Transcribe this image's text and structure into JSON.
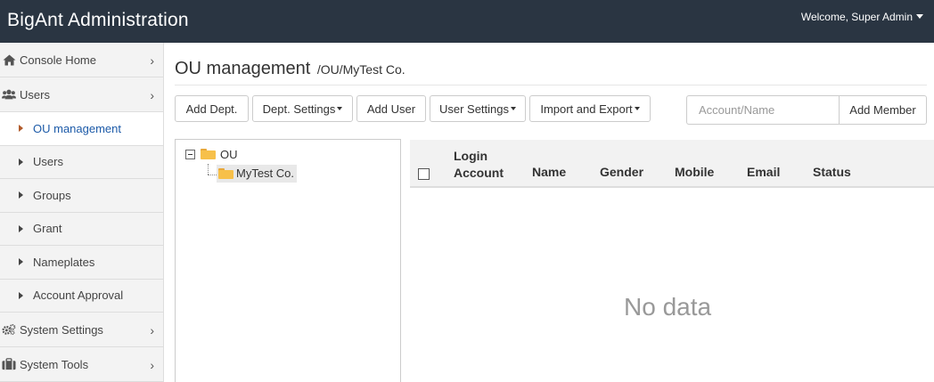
{
  "app": {
    "title": "BigAnt Administration",
    "welcome": "Welcome, Super Admin"
  },
  "sidebar": {
    "console_home": "Console Home",
    "users": "Users",
    "sub_items": [
      "OU management",
      "Users",
      "Groups",
      "Grant",
      "Nameplates",
      "Account Approval"
    ],
    "system_settings": "System Settings",
    "system_tools": "System Tools",
    "active_item": "OU management"
  },
  "page": {
    "title": "OU management",
    "breadcrumb": "/OU/MyTest Co."
  },
  "toolbar": {
    "add_dept": "Add Dept.",
    "dept_settings": "Dept. Settings",
    "add_user": "Add User",
    "user_settings": "User Settings",
    "import_export": "Import and Export",
    "search_placeholder": "Account/Name",
    "add_member": "Add Member"
  },
  "tree": {
    "root": "OU",
    "child": "MyTest Co."
  },
  "table": {
    "columns": {
      "login_line1": "Login",
      "login_line2": "Account",
      "name": "Name",
      "gender": "Gender",
      "mobile": "Mobile",
      "email": "Email",
      "status": "Status"
    },
    "empty_text": "No data"
  }
}
